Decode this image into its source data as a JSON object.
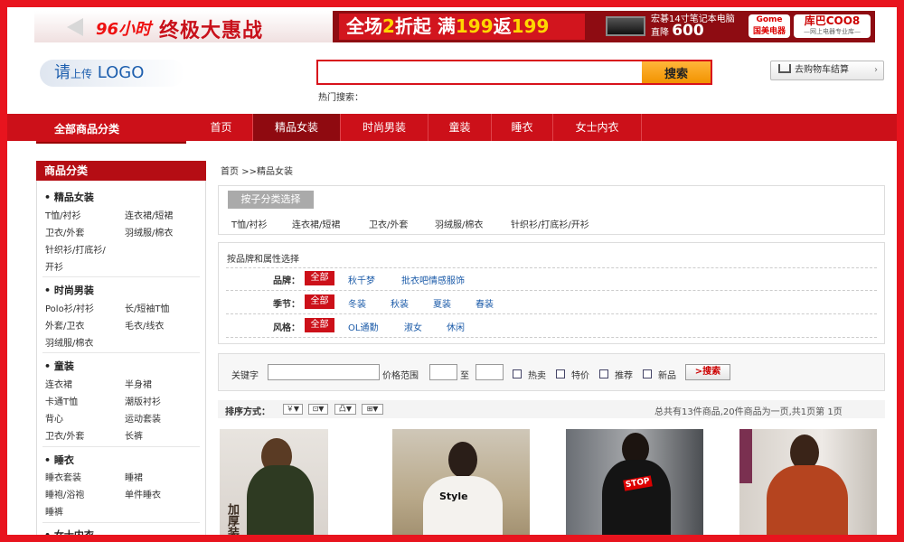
{
  "banner": {
    "days": "96小时",
    "title": "终极大惠战",
    "promo_a": "全场",
    "promo_num": "2",
    "promo_b": "折起 满",
    "promo_c": "199",
    "promo_d": "返",
    "promo_e": "199",
    "ad_line": "宏碁14寸笔记本电脑",
    "ad_prefix": "直降",
    "ad_price": "600",
    "partner1": "Gome",
    "partner1_sub": "国美电器",
    "partner2": "库巴COO8",
    "partner2_sub": "—网上电器专业库—"
  },
  "header": {
    "logo_main": "请",
    "logo_sub": "上传",
    "logo_text": "LOGO",
    "search_value": "",
    "search_button": "搜索",
    "hot_label": "热门搜索：",
    "cart_label": "去购物车结算"
  },
  "nav": {
    "all_categories": "全部商品分类",
    "items": [
      "首页",
      "精品女装",
      "时尚男装",
      "童装",
      "睡衣",
      "女士内衣"
    ]
  },
  "sidebar": {
    "title": "商品分类",
    "groups": [
      {
        "name": "精品女装",
        "links": [
          "T恤/衬衫",
          "连衣裙/短裙",
          "卫衣/外套",
          "羽绒服/棉衣",
          "针织衫/打底衫/",
          "开衫"
        ]
      },
      {
        "name": "时尚男装",
        "links": [
          "Polo衫/衬衫",
          "长/短袖T恤",
          "外套/卫衣",
          "毛衣/线衣",
          "羽绒服/棉衣"
        ]
      },
      {
        "name": "童装",
        "links": [
          "连衣裙",
          "半身裙",
          "卡通T恤",
          "潮版衬衫",
          "背心",
          "运动套装",
          "卫衣/外套",
          "长裤"
        ]
      },
      {
        "name": "睡衣",
        "links": [
          "睡衣套装",
          "睡裙",
          "睡袍/浴袍",
          "单件睡衣",
          "睡裤"
        ]
      },
      {
        "name": "女士内衣",
        "links": []
      }
    ]
  },
  "breadcrumb": {
    "home": "首页",
    "sep": ">>",
    "current": "精品女装"
  },
  "subcategory": {
    "tag": "按子分类选择",
    "links": [
      "T恤/衬衫",
      "连衣裙/短裙",
      "卫衣/外套",
      "羽绒服/棉衣",
      "针织衫/打底衫/开衫"
    ]
  },
  "attributes": {
    "title": "按品牌和属性选择",
    "all_label": "全部",
    "rows": [
      {
        "label": "品牌：",
        "values": [
          "秋千梦",
          "批衣吧情感服饰"
        ]
      },
      {
        "label": "季节：",
        "values": [
          "冬装",
          "秋装",
          "夏装",
          "春装"
        ]
      },
      {
        "label": "风格：",
        "values": [
          "OL通勤",
          "淑女",
          "休闲"
        ]
      }
    ]
  },
  "filter": {
    "keyword_label": "关键字",
    "keyword_value": "",
    "price_label": "价格范围",
    "price_min": "",
    "to_label": "至",
    "price_max": "",
    "checks": [
      "热卖",
      "特价",
      "推荐",
      "新品"
    ],
    "search_button": ">搜索"
  },
  "sort": {
    "label": "排序方式：",
    "buttons": [
      "￥▼",
      "⊡▼",
      "凸▼",
      "⊞▼"
    ],
    "summary": "总共有13件商品,20件商品为一页,共1页第  1页"
  },
  "products": [
    {
      "overlay": "加厚装"
    },
    {
      "overlay": "Style"
    },
    {
      "overlay": "STOP"
    },
    {
      "overlay": ""
    }
  ]
}
